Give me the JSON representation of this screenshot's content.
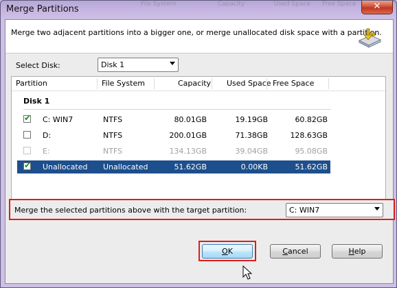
{
  "window": {
    "title": "Merge Partitions",
    "close_glyph": "✕",
    "background_tabs": [
      "File System",
      "Capacity",
      "Used Space",
      "Free Space"
    ]
  },
  "header": {
    "description": "Merge two adjacent partitions into a bigger one, or merge unallocated disk space with a partition.",
    "icon": "merge-partition-icon"
  },
  "disk_select": {
    "label": "Select Disk:",
    "value": "Disk 1"
  },
  "table": {
    "columns": [
      "Partition",
      "File System",
      "Capacity",
      "Used Space",
      "Free Space"
    ],
    "group_label": "Disk 1",
    "rows": [
      {
        "checked": true,
        "enabled": true,
        "selected": false,
        "partition": "C:  WIN7",
        "fs": "NTFS",
        "capacity": "80.01GB",
        "used": "19.19GB",
        "free": "60.82GB"
      },
      {
        "checked": false,
        "enabled": true,
        "selected": false,
        "partition": "D:",
        "fs": "NTFS",
        "capacity": "200.01GB",
        "used": "71.38GB",
        "free": "128.63GB"
      },
      {
        "checked": false,
        "enabled": false,
        "selected": false,
        "partition": "E:",
        "fs": "NTFS",
        "capacity": "134.13GB",
        "used": "39.04GB",
        "free": "95.08GB"
      },
      {
        "checked": true,
        "enabled": true,
        "selected": true,
        "partition": "Unallocated",
        "fs": "Unallocated",
        "capacity": "51.62GB",
        "used": "0.00KB",
        "free": "51.62GB"
      }
    ]
  },
  "target": {
    "label": "Merge the selected partitions above with the target partition:",
    "value": "C:  WIN7"
  },
  "buttons": {
    "ok": "OK",
    "cancel": "Cancel",
    "help": "Help"
  },
  "colors": {
    "selection": "#1d4f8c",
    "highlight_frame": "#e01b1b",
    "check": "#1c8c1c"
  }
}
